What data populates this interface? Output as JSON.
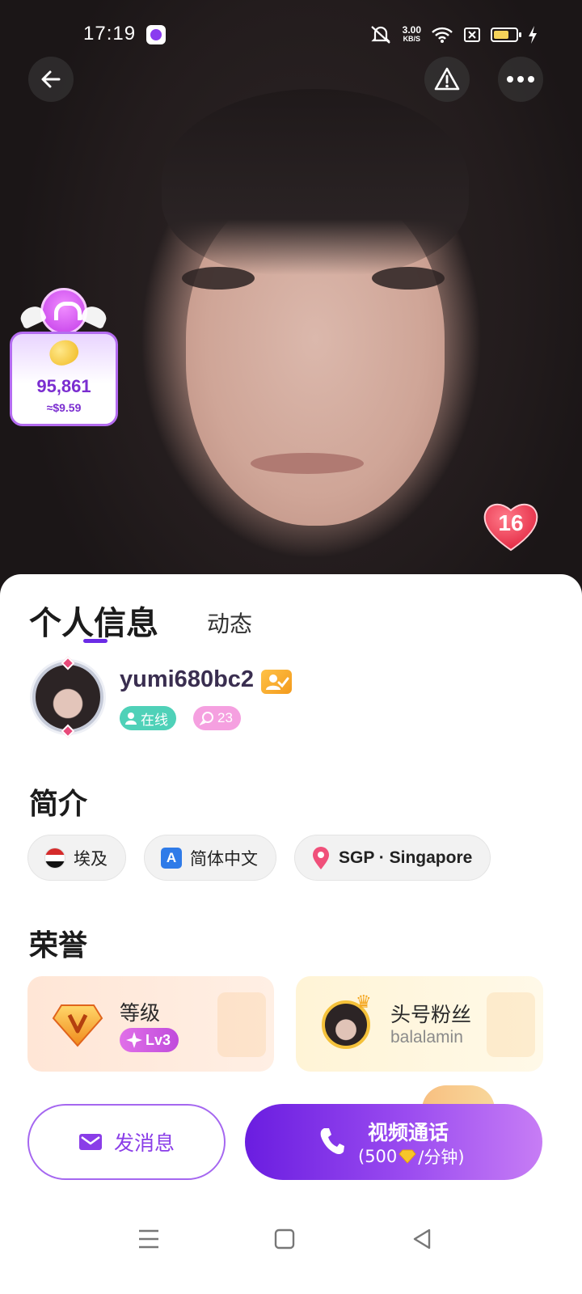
{
  "status_bar": {
    "time": "17:19",
    "net_speed_value": "3.00",
    "net_speed_unit": "KB/S",
    "icons": [
      "app-notification-icon",
      "mute-icon",
      "wifi-icon",
      "sim-off-icon",
      "battery-icon",
      "charging-icon"
    ]
  },
  "header": {
    "back_icon": "arrow-left-icon",
    "report_icon": "warning-icon",
    "more_icon": "more-dots-icon"
  },
  "coins": {
    "value": "95,861",
    "usd": "≈$9.59"
  },
  "likes": {
    "count": "16"
  },
  "tabs": [
    {
      "label": "个人信息",
      "active": true
    },
    {
      "label": "动态",
      "active": false
    }
  ],
  "profile": {
    "username": "yumi680bc2",
    "online_label": "在线",
    "comment_count": "23"
  },
  "intro": {
    "title": "简介",
    "chips": [
      {
        "label": "埃及",
        "icon": "egypt-flag-icon"
      },
      {
        "label": "简体中文",
        "icon": "language-icon"
      },
      {
        "label": "SGP · Singapore",
        "icon": "location-pin-icon"
      }
    ]
  },
  "honor": {
    "title": "荣誉",
    "level_label": "等级",
    "level_value": "Lv3",
    "fan_label": "头号粉丝",
    "fan_name": "balalamin"
  },
  "actions": {
    "message_label": "发消息",
    "call_label": "视频通话",
    "call_price_open": "(500",
    "call_price_close": "/分钟)"
  },
  "colors": {
    "accent": "#6b2be6",
    "online": "#4fd1b8",
    "like": "#e8334d"
  }
}
